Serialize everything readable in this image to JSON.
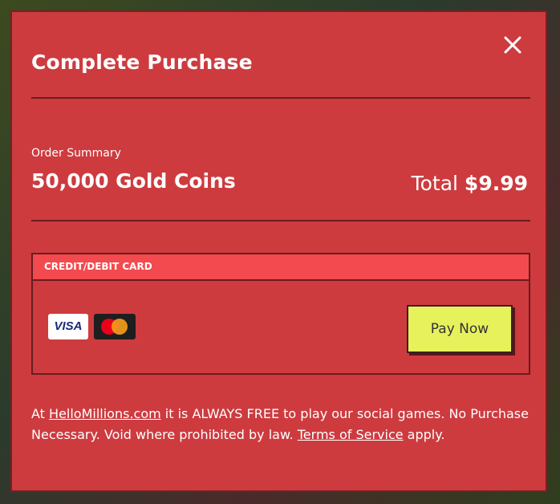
{
  "modal": {
    "title": "Complete Purchase",
    "close_icon": "close-icon"
  },
  "order": {
    "summary_label": "Order Summary",
    "product_name": "50,000 Gold Coins",
    "total_label": "Total",
    "total_amount": "$9.99"
  },
  "payment": {
    "method_label": "CREDIT/DEBIT CARD",
    "card_logos": [
      {
        "name": "visa-logo",
        "text": "VISA"
      },
      {
        "name": "mastercard-logo"
      }
    ],
    "pay_button_label": "Pay Now"
  },
  "disclaimer": {
    "prefix": "At ",
    "site_link": "HelloMillions.com",
    "middle": " it is ALWAYS FREE to play our social games. No Purchase Necessary. Void where prohibited by law. ",
    "terms_link": "Terms of Service",
    "suffix": " apply."
  },
  "colors": {
    "modal_background": "#cd3b3f",
    "header_strip": "#f24a4e",
    "pay_button": "#e7f15c",
    "border": "#6a1c1e",
    "mastercard_red": "#eb001b",
    "mastercard_orange": "#f79e1b"
  }
}
